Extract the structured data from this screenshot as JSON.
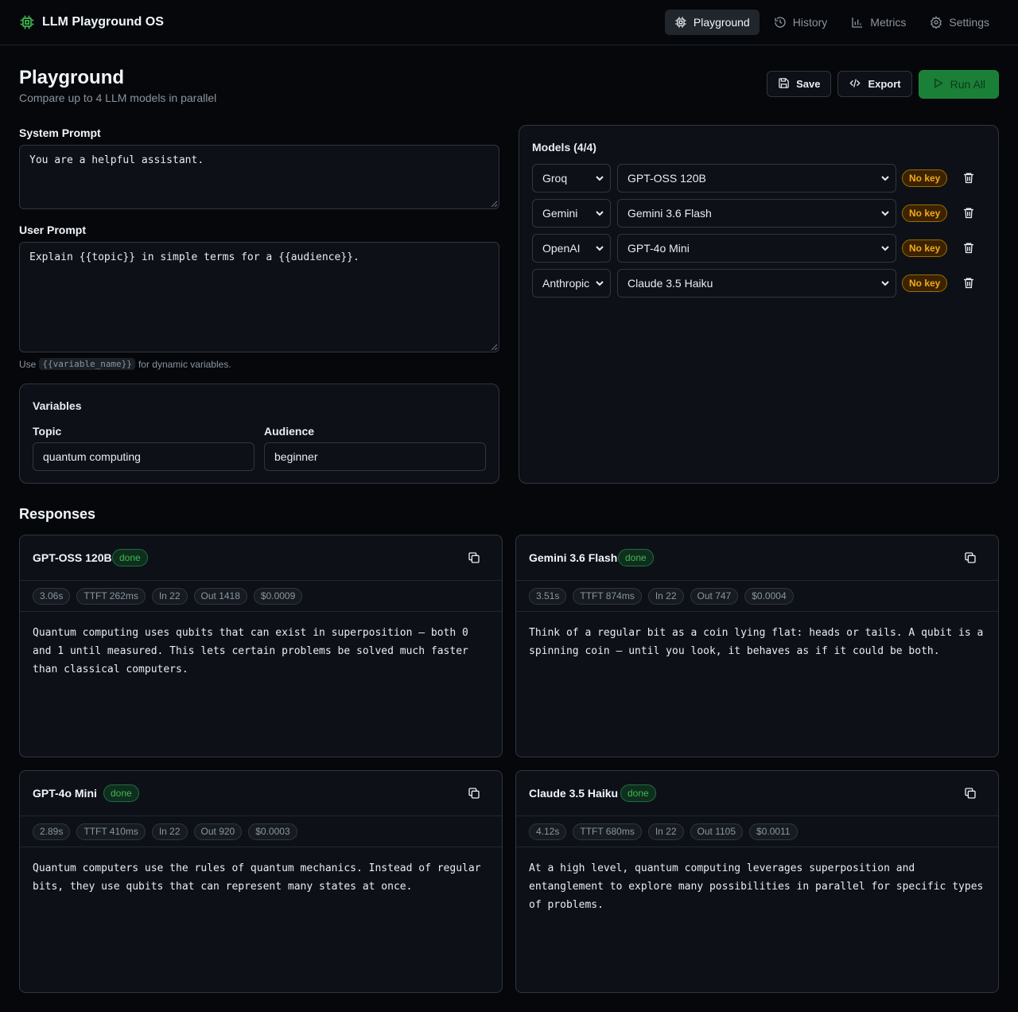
{
  "app": {
    "title": "LLM Playground OS"
  },
  "nav": [
    {
      "label": "Playground",
      "icon": "cpu-icon",
      "active": true
    },
    {
      "label": "History",
      "icon": "history-icon",
      "active": false
    },
    {
      "label": "Metrics",
      "icon": "bar-chart-icon",
      "active": false
    },
    {
      "label": "Settings",
      "icon": "gear-icon",
      "active": false
    }
  ],
  "header": {
    "title": "Playground",
    "subtitle": "Compare up to 4 LLM models in parallel"
  },
  "toolbar": {
    "save_label": "Save",
    "export_label": "Export",
    "run_label": "Run All"
  },
  "prompts": {
    "system_label": "System Prompt",
    "system_value": "You are a helpful assistant.",
    "user_label": "User Prompt",
    "user_value": "Explain {{topic}} in simple terms for a {{audience}}.",
    "hint_prefix": "Use",
    "hint_code": "{{variable_name}}",
    "hint_suffix": "for dynamic variables."
  },
  "variables": {
    "title": "Variables",
    "items": [
      {
        "label": "Topic",
        "value": "quantum computing"
      },
      {
        "label": "Audience",
        "value": "beginner"
      }
    ]
  },
  "models": {
    "title": "Models (4/4)",
    "rows": [
      {
        "provider": "Groq",
        "model": "GPT-OSS 120B",
        "status": "No key"
      },
      {
        "provider": "Gemini",
        "model": "Gemini 3.6 Flash",
        "status": "No key"
      },
      {
        "provider": "OpenAI",
        "model": "GPT-4o Mini",
        "status": "No key"
      },
      {
        "provider": "Anthropic",
        "model": "Claude 3.5 Haiku",
        "status": "No key"
      }
    ]
  },
  "responses": {
    "title": "Responses",
    "cards": [
      {
        "name": "GPT-OSS 120B",
        "status": "done",
        "metrics": [
          "3.06s",
          "TTFT 262ms",
          "In 22",
          "Out 1418",
          "$0.0009"
        ],
        "text": "Quantum computing uses qubits that can exist in superposition — both 0 and 1 until measured. This lets certain problems be solved much faster than classical computers."
      },
      {
        "name": "Gemini 3.6 Flash",
        "status": "done",
        "metrics": [
          "3.51s",
          "TTFT 874ms",
          "In 22",
          "Out 747",
          "$0.0004"
        ],
        "text": "Think of a regular bit as a coin lying flat: heads or tails. A qubit is a spinning coin — until you look, it behaves as if it could be both."
      },
      {
        "name": "GPT-4o Mini",
        "status": "done",
        "metrics": [
          "2.89s",
          "TTFT 410ms",
          "In 22",
          "Out 920",
          "$0.0003"
        ],
        "text": "Quantum computers use the rules of quantum mechanics. Instead of regular bits, they use qubits that can represent many states at once."
      },
      {
        "name": "Claude 3.5 Haiku",
        "status": "done",
        "metrics": [
          "4.12s",
          "TTFT 680ms",
          "In 22",
          "Out 1105",
          "$0.0011"
        ],
        "text": "At a high level, quantum computing leverages superposition and entanglement to explore many possibilities in parallel for specific types of problems."
      }
    ]
  },
  "colors": {
    "accent": "#238636",
    "warning": "#f2a91c",
    "success": "#3fb950"
  }
}
